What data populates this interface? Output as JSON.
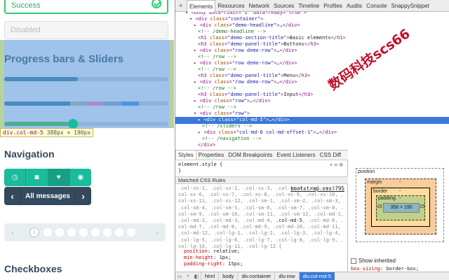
{
  "page": {
    "success_label": "Success",
    "disabled_placeholder": "Disabled",
    "progress_title": "Progress bars & Sliders",
    "progress1": 0.45,
    "progress2_segments": [
      {
        "width": 0.4,
        "color": "#4a8ac0"
      },
      {
        "width": 0.1,
        "color": "#7fa7c9"
      },
      {
        "width": 0.1,
        "color": "#a98ec9"
      },
      {
        "width": 0.12,
        "color": "#6fa0d4"
      },
      {
        "width": 0.1,
        "color": "#4f93e3"
      }
    ],
    "slider_value": 0.42,
    "inspect_tooltip": {
      "tag": "div.col-md-5",
      "dims": "388px × 190px"
    },
    "navigation_title": "Navigation",
    "icon_buttons": [
      {
        "name": "clock-icon",
        "glyph": "◷"
      },
      {
        "name": "camera-icon",
        "glyph": "◙"
      },
      {
        "name": "heart-icon",
        "glyph": "♥"
      },
      {
        "name": "eye-icon",
        "glyph": "◉"
      }
    ],
    "all_messages_label": "All messages",
    "pager_active_number": "1",
    "pager_dot_count": 8,
    "checkboxes_title": "Checkboxes"
  },
  "devtools": {
    "close_glyph": "×",
    "tabs": [
      "Elements",
      "Resources",
      "Network",
      "Sources",
      "Timeline",
      "Profiles",
      "Audits",
      "Console",
      "SnappySnippet"
    ],
    "active_tab": 0,
    "dom_lines": [
      {
        "indent": 2,
        "html": "▾ <span class='tg'>&lt;body data-limit=\"1\" data-ready=\"true\"&gt;</span>"
      },
      {
        "indent": 3,
        "html": "▾ <span class='tg'>&lt;div</span> <span class='an'>class</span>=<span class='av'>\"container\"</span><span class='tg'>&gt;</span>"
      },
      {
        "indent": 4,
        "html": "▸ <span class='tg'>&lt;div</span> <span class='an'>class</span>=<span class='av'>\"demo-headline\"</span><span class='tg'>&gt;</span><span class='tx'>…</span><span class='tg'>&lt;/div&gt;</span>"
      },
      {
        "indent": 5,
        "html": "<span class='cm'>&lt;!-- /demo-headline --&gt;</span>"
      },
      {
        "indent": 5,
        "html": "<span class='tg'>&lt;h1</span> <span class='an'>class</span>=<span class='av'>\"demo-section-title\"</span><span class='tg'>&gt;</span><span class='tx'>Basic elements</span><span class='tg'>&lt;/h1&gt;</span>"
      },
      {
        "indent": 5,
        "html": "<span class='tg'>&lt;h3</span> <span class='an'>class</span>=<span class='av'>\"demo-panel-title\"</span><span class='tg'>&gt;</span><span class='tx'>Buttons</span><span class='tg'>&lt;/h3&gt;</span>"
      },
      {
        "indent": 4,
        "html": "▸ <span class='tg'>&lt;div</span> <span class='an'>class</span>=<span class='av'>\"row demo-row\"</span><span class='tg'>&gt;</span><span class='tx'>…</span><span class='tg'>&lt;/div&gt;</span>"
      },
      {
        "indent": 5,
        "html": "<span class='cm'>&lt;!-- /row --&gt;</span>"
      },
      {
        "indent": 4,
        "html": "▸ <span class='tg'>&lt;div</span> <span class='an'>class</span>=<span class='av'>\"row demo-row\"</span><span class='tg'>&gt;</span><span class='tx'>…</span><span class='tg'>&lt;/div&gt;</span>"
      },
      {
        "indent": 5,
        "html": "<span class='cm'>&lt;!-- /row --&gt;</span>"
      },
      {
        "indent": 5,
        "html": "<span class='tg'>&lt;h3</span> <span class='an'>class</span>=<span class='av'>\"demo-panel-title\"</span><span class='tg'>&gt;</span><span class='tx'>Menu</span><span class='tg'>&lt;/h3&gt;</span>"
      },
      {
        "indent": 4,
        "html": "▸ <span class='tg'>&lt;div</span> <span class='an'>class</span>=<span class='av'>\"row demo-row\"</span><span class='tg'>&gt;</span><span class='tx'>…</span><span class='tg'>&lt;/div&gt;</span>"
      },
      {
        "indent": 5,
        "html": "<span class='cm'>&lt;!-- /row --&gt;</span>"
      },
      {
        "indent": 5,
        "html": "<span class='tg'>&lt;h3</span> <span class='an'>class</span>=<span class='av'>\"demo-panel-title\"</span><span class='tg'>&gt;</span><span class='tx'>Input</span><span class='tg'>&lt;/h3&gt;</span>"
      },
      {
        "indent": 4,
        "html": "▸ <span class='tg'>&lt;div</span> <span class='an'>class</span>=<span class='av'>\"row\"</span><span class='tg'>&gt;</span><span class='tx'>…</span><span class='tg'>&lt;/div&gt;</span>"
      },
      {
        "indent": 5,
        "html": "<span class='cm'>&lt;!-- /row --&gt;</span>"
      },
      {
        "indent": 4,
        "html": "▾ <span class='tg'>&lt;div</span> <span class='an'>class</span>=<span class='av'>\"row\"</span><span class='tg'>&gt;</span>"
      },
      {
        "indent": 5,
        "selected": true,
        "html": "▸ <span class='tg'>&lt;div</span> <span class='an'>class</span>=<span class='av'>\"col-md-5\"</span><span class='tg'>&gt;</span><span class='tx'>…</span><span class='tg'>&lt;/div&gt;</span>"
      },
      {
        "indent": 6,
        "html": "<span class='cm'>&lt;!-- /sliders --&gt;</span>"
      },
      {
        "indent": 5,
        "html": "▸ <span class='tg'>&lt;div</span> <span class='an'>class</span>=<span class='av'>\"col-md-6 col-md-offset-1\"</span><span class='tg'>&gt;</span><span class='tx'>…</span><span class='tg'>&lt;/div&gt;</span>"
      },
      {
        "indent": 6,
        "html": "<span class='cm'>&lt;!-- /navigation --&gt;</span>"
      },
      {
        "indent": 5,
        "html": "<span class='tg'>&lt;/div&gt;</span>"
      }
    ],
    "watermark": "数码科技scs66",
    "sub_tabs": [
      "Styles",
      "Properties",
      "DOM Breakpoints",
      "Event Listeners",
      "CSS Diff"
    ],
    "active_sub_tab": 0,
    "element_style_lines": [
      "element.style {",
      "}"
    ],
    "element_style_tools": "+ ⌗ ✲",
    "matched_header": "Matched CSS Rules",
    "rule_source": "bootstrap.css:795",
    "selectors_before": ".col-xs-1, .col-xs-2, .col-xs-3, .col-xs-4, .col-xs-5, .col-xs-6, .col-xs-7, .col-xs-8, .col-xs-9, .col-xs-10, .col-xs-11, .col-xs-12, .col-sm-1, .col-sm-2, .col-sm-3, .col-sm-4, .col-sm-5, .col-sm-6, .col-sm-7, .col-sm-8, .col-sm-9, .col-sm-10, .col-sm-11, .col-sm-12, .col-md-1, .col-md-2, .col-md-3, .col-md-4, ",
    "selector_highlight": ".col-md-5",
    "selectors_after": ", .col-md-6, .col-md-7, .col-md-8, .col-md-9, .col-md-10, .col-md-11, .col-md-12, .col-lg-1, .col-lg-2, .col-lg-3, .col-lg-4, .col-lg-5, .col-lg-6, .col-lg-7, .col-lg-8, .col-lg-9, .col-lg-10, .col-lg-11, .col-lg-12 {",
    "properties": [
      {
        "name": "position",
        "value": "relative;"
      },
      {
        "name": "min-height",
        "value": "1px;"
      },
      {
        "name": "padding-right",
        "value": "15px;"
      }
    ],
    "box_model": {
      "position_label": "position",
      "margin_label": "margin",
      "margin_value": "-",
      "border_label": "border",
      "border_value": "-",
      "padding_label": "padding",
      "padding_value": "-",
      "padding_left": "15",
      "padding_right": "15",
      "content": "358 × 190"
    },
    "show_inherited_label": "Show inherited",
    "boxsizing_prop": "box-sizing",
    "boxsizing_value": "border-box;",
    "breadcrumbs": [
      "html",
      "body",
      "div.container",
      "div.row",
      "div.col-md-5"
    ],
    "active_breadcrumb": 4
  }
}
